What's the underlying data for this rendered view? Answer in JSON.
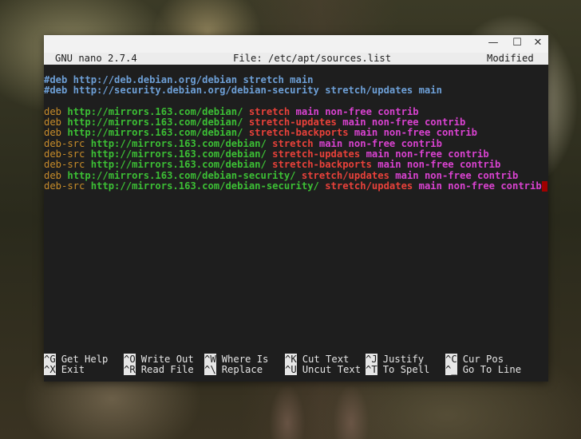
{
  "window": {
    "minimize_glyph": "—",
    "maximize_glyph": "☐",
    "close_glyph": "✕"
  },
  "header": {
    "app": "GNU nano 2.7.4",
    "file": "File: /etc/apt/sources.list",
    "status": "Modified"
  },
  "lines": [
    [
      {
        "t": "#deb http://deb.debian.org/debian stretch main",
        "c": "comment"
      }
    ],
    [
      {
        "t": "#deb http://security.debian.org/debian-security stretch/updates main",
        "c": "comment"
      }
    ],
    [],
    [
      {
        "t": "deb ",
        "c": "kw"
      },
      {
        "t": "http://mirrors.163.com/debian/ ",
        "c": "url"
      },
      {
        "t": "stretch ",
        "c": "dist"
      },
      {
        "t": "main non-free contrib",
        "c": "comp"
      }
    ],
    [
      {
        "t": "deb ",
        "c": "kw"
      },
      {
        "t": "http://mirrors.163.com/debian/ ",
        "c": "url"
      },
      {
        "t": "stretch-updates ",
        "c": "dist"
      },
      {
        "t": "main non-free contrib",
        "c": "comp"
      }
    ],
    [
      {
        "t": "deb ",
        "c": "kw"
      },
      {
        "t": "http://mirrors.163.com/debian/ ",
        "c": "url"
      },
      {
        "t": "stretch-backports ",
        "c": "dist"
      },
      {
        "t": "main non-free contrib",
        "c": "comp"
      }
    ],
    [
      {
        "t": "deb-src ",
        "c": "kw"
      },
      {
        "t": "http://mirrors.163.com/debian/ ",
        "c": "url"
      },
      {
        "t": "stretch ",
        "c": "dist"
      },
      {
        "t": "main non-free contrib",
        "c": "comp"
      }
    ],
    [
      {
        "t": "deb-src ",
        "c": "kw"
      },
      {
        "t": "http://mirrors.163.com/debian/ ",
        "c": "url"
      },
      {
        "t": "stretch-updates ",
        "c": "dist"
      },
      {
        "t": "main non-free contrib",
        "c": "comp"
      }
    ],
    [
      {
        "t": "deb-src ",
        "c": "kw"
      },
      {
        "t": "http://mirrors.163.com/debian/ ",
        "c": "url"
      },
      {
        "t": "stretch-backports ",
        "c": "dist"
      },
      {
        "t": "main non-free contrib",
        "c": "comp"
      }
    ],
    [
      {
        "t": "deb ",
        "c": "kw"
      },
      {
        "t": "http://mirrors.163.com/debian-security/ ",
        "c": "url"
      },
      {
        "t": "stretch/updates ",
        "c": "dist"
      },
      {
        "t": "main non-free contrib",
        "c": "comp"
      }
    ],
    [
      {
        "t": "deb-src ",
        "c": "kw"
      },
      {
        "t": "http://mirrors.163.com/debian-security/ ",
        "c": "url"
      },
      {
        "t": "stretch/updates ",
        "c": "dist"
      },
      {
        "t": "main non-free contrib",
        "c": "comp"
      }
    ]
  ],
  "shortcuts": {
    "row1": [
      {
        "key": "^G",
        "label": "Get Help"
      },
      {
        "key": "^O",
        "label": "Write Out"
      },
      {
        "key": "^W",
        "label": "Where Is"
      },
      {
        "key": "^K",
        "label": "Cut Text"
      },
      {
        "key": "^J",
        "label": "Justify"
      },
      {
        "key": "^C",
        "label": "Cur Pos"
      }
    ],
    "row2": [
      {
        "key": "^X",
        "label": "Exit"
      },
      {
        "key": "^R",
        "label": "Read File"
      },
      {
        "key": "^\\",
        "label": "Replace"
      },
      {
        "key": "^U",
        "label": "Uncut Text"
      },
      {
        "key": "^T",
        "label": "To Spell"
      },
      {
        "key": "^_",
        "label": "Go To Line"
      }
    ]
  },
  "colors": {
    "comment": "#6d9fd6",
    "keyword": "#c78c29",
    "url": "#3cbf35",
    "distribution": "#e8413a",
    "component": "#d942d0",
    "cursor": "#a00000"
  }
}
